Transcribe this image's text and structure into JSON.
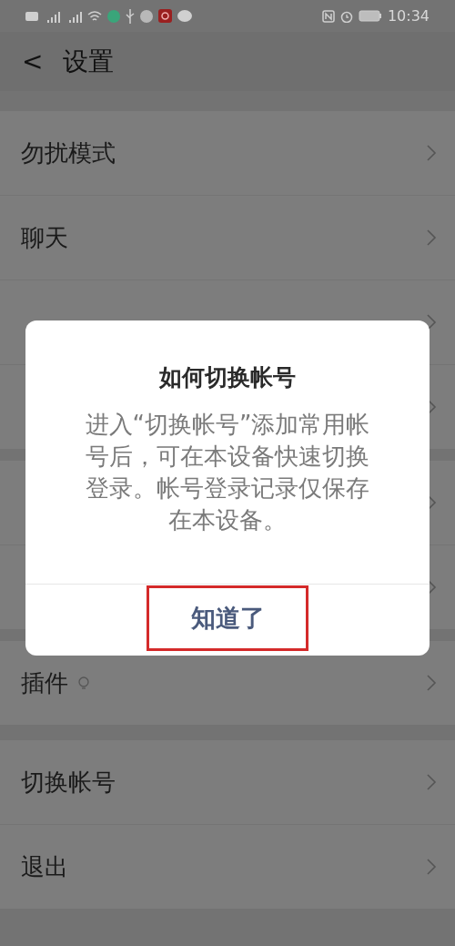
{
  "status_bar": {
    "time": "10:34"
  },
  "header": {
    "back": "<",
    "title": "设置"
  },
  "sections": [
    {
      "rows": [
        {
          "label": "勿扰模式"
        },
        {
          "label": "聊天"
        },
        {},
        {}
      ]
    },
    {
      "rows": [
        {},
        {}
      ]
    },
    {
      "rows": [
        {
          "label": "插件",
          "badge": true
        }
      ]
    },
    {
      "rows": [
        {
          "label": "切换帐号"
        },
        {
          "label": "退出"
        }
      ]
    }
  ],
  "dialog": {
    "title": "如何切换帐号",
    "body": "进入“切换帐号”添加常用帐号后，可在本设备快速切换登录。帐号登录记录仅保存在本设备。",
    "button": "知道了",
    "highlighted": true
  }
}
